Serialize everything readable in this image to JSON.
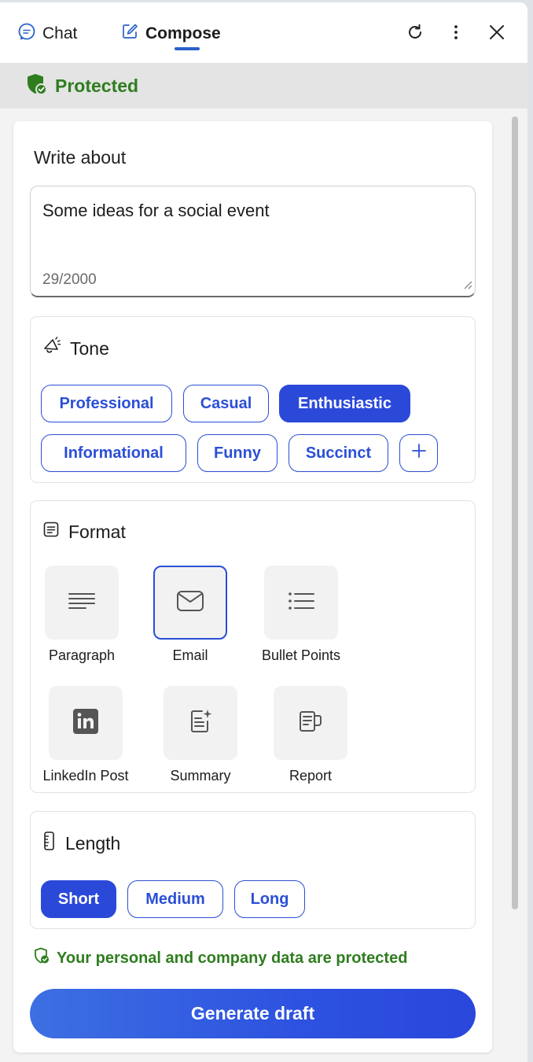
{
  "header": {
    "tabs": [
      {
        "label": "Chat",
        "icon": "chat-icon"
      },
      {
        "label": "Compose",
        "icon": "compose-icon",
        "active": true
      }
    ],
    "actions": [
      "refresh-icon",
      "more-icon",
      "close-icon"
    ]
  },
  "protected_bar": {
    "label": "Protected",
    "color": "#2f7d1f"
  },
  "compose": {
    "write_about_label": "Write about",
    "input_value": "Some ideas for a social event",
    "char_count": "29/2000"
  },
  "tone": {
    "title": "Tone",
    "options": [
      {
        "label": "Professional",
        "selected": false
      },
      {
        "label": "Casual",
        "selected": false
      },
      {
        "label": "Enthusiastic",
        "selected": true
      },
      {
        "label": "Informational",
        "selected": false
      },
      {
        "label": "Funny",
        "selected": false
      },
      {
        "label": "Succinct",
        "selected": false
      }
    ],
    "add_icon": "plus-icon"
  },
  "format": {
    "title": "Format",
    "options": [
      {
        "label": "Paragraph",
        "icon": "paragraph-icon",
        "selected": false
      },
      {
        "label": "Email",
        "icon": "email-icon",
        "selected": true
      },
      {
        "label": "Bullet Points",
        "icon": "bullet-list-icon",
        "selected": false
      },
      {
        "label": "LinkedIn Post",
        "icon": "linkedin-icon",
        "selected": false
      },
      {
        "label": "Summary",
        "icon": "summary-icon",
        "selected": false
      },
      {
        "label": "Report",
        "icon": "report-icon",
        "selected": false
      }
    ]
  },
  "length": {
    "title": "Length",
    "options": [
      {
        "label": "Short",
        "selected": true
      },
      {
        "label": "Medium",
        "selected": false
      },
      {
        "label": "Long",
        "selected": false
      }
    ]
  },
  "privacy_note": "Your personal and company data are protected",
  "generate_label": "Generate draft",
  "colors": {
    "accent": "#2b4fd6",
    "accent_fill": "#2b49d9",
    "success": "#2f7d1f"
  }
}
